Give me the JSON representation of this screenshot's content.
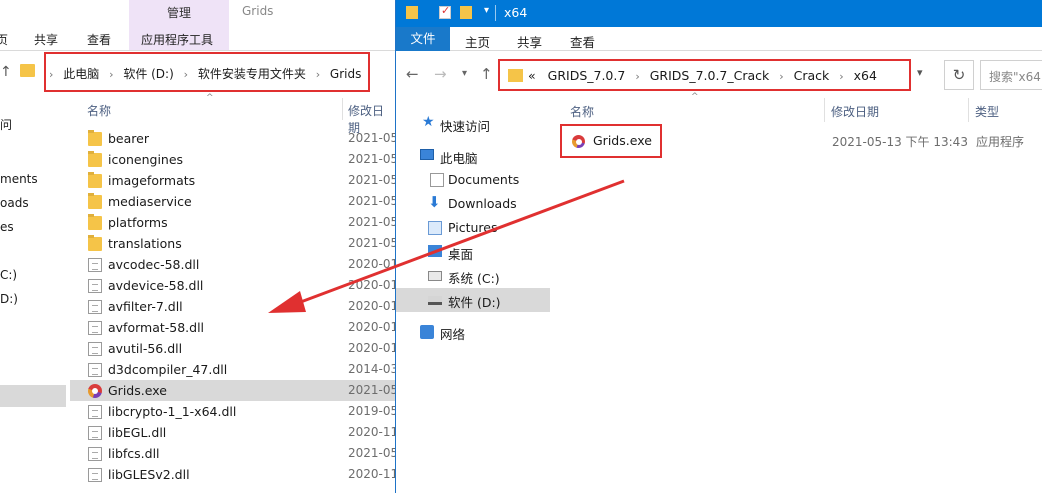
{
  "left_window": {
    "title": "Grids",
    "context_tab": "管理",
    "tabs": [
      "页",
      "共享",
      "查看",
      "应用程序工具"
    ],
    "breadcrumb": [
      "此电脑",
      "软件 (D:)",
      "软件安装专用文件夹",
      "Grids"
    ],
    "nav_items": [
      "问",
      "ments",
      "oads",
      "es",
      "C:)",
      "D:)"
    ],
    "columns": {
      "name": "名称",
      "date": "修改日期"
    },
    "files": [
      {
        "name": "bearer",
        "date": "2021-05",
        "icon": "folder"
      },
      {
        "name": "iconengines",
        "date": "2021-05",
        "icon": "folder"
      },
      {
        "name": "imageformats",
        "date": "2021-05",
        "icon": "folder"
      },
      {
        "name": "mediaservice",
        "date": "2021-05",
        "icon": "folder"
      },
      {
        "name": "platforms",
        "date": "2021-05",
        "icon": "folder"
      },
      {
        "name": "translations",
        "date": "2021-05",
        "icon": "folder"
      },
      {
        "name": "avcodec-58.dll",
        "date": "2020-01",
        "icon": "file"
      },
      {
        "name": "avdevice-58.dll",
        "date": "2020-01",
        "icon": "file"
      },
      {
        "name": "avfilter-7.dll",
        "date": "2020-01",
        "icon": "file"
      },
      {
        "name": "avformat-58.dll",
        "date": "2020-01",
        "icon": "file"
      },
      {
        "name": "avutil-56.dll",
        "date": "2020-01",
        "icon": "file"
      },
      {
        "name": "d3dcompiler_47.dll",
        "date": "2014-03",
        "icon": "file"
      },
      {
        "name": "Grids.exe",
        "date": "2021-05",
        "icon": "grids"
      },
      {
        "name": "libcrypto-1_1-x64.dll",
        "date": "2019-05",
        "icon": "file"
      },
      {
        "name": "libEGL.dll",
        "date": "2020-11",
        "icon": "file"
      },
      {
        "name": "libfcs.dll",
        "date": "2021-05",
        "icon": "file"
      },
      {
        "name": "libGLESv2.dll",
        "date": "2020-11",
        "icon": "file"
      }
    ]
  },
  "right_window": {
    "title": "x64",
    "tabs": {
      "file": "文件",
      "home": "主页",
      "share": "共享",
      "view": "查看"
    },
    "breadcrumb_prefix": "«",
    "breadcrumb": [
      "GRIDS_7.0.7",
      "GRIDS_7.0.7_Crack",
      "Crack",
      "x64"
    ],
    "search_placeholder": "搜索\"x64\"",
    "nav": {
      "quick_access": "快速访问",
      "this_pc": "此电脑",
      "documents": "Documents",
      "downloads": "Downloads",
      "pictures": "Pictures",
      "desktop": "桌面",
      "drive_c": "系统 (C:)",
      "drive_d": "软件 (D:)",
      "network": "网络"
    },
    "columns": {
      "name": "名称",
      "date": "修改日期",
      "type": "类型"
    },
    "file": {
      "name": "Grids.exe",
      "date": "2021-05-13 下午 13:43",
      "type": "应用程序"
    }
  },
  "colors": {
    "highlight": "#e03030",
    "titlebar": "#0078d7",
    "selection": "#d9d9d9"
  }
}
